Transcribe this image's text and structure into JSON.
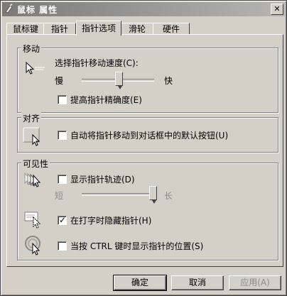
{
  "window": {
    "title": "鼠标 属性"
  },
  "tabs": [
    {
      "label": "鼠标键",
      "active": false
    },
    {
      "label": "指针",
      "active": false
    },
    {
      "label": "指针选项",
      "active": true
    },
    {
      "label": "滑轮",
      "active": false
    },
    {
      "label": "硬件",
      "active": false
    }
  ],
  "motion": {
    "title": "移动",
    "speed_label": "选择指针移动速度(C):",
    "slow": "慢",
    "fast": "快",
    "speed_level": 0.5,
    "precision_label": "提高指针精确度(E)",
    "precision_checked": false
  },
  "snap": {
    "title": "对齐",
    "label": "自动将指针移动到对话框中的默认按钮(U)",
    "checked": false
  },
  "visibility": {
    "title": "可见性",
    "trails_label": "显示指针轨迹(D)",
    "trails_checked": false,
    "short": "短",
    "long": "长",
    "trails_level": 1.0,
    "hide_label": "在打字时隐藏指针(H)",
    "hide_checked": true,
    "ctrl_label": "当按 CTRL 键时显示指针的位置(S)",
    "ctrl_checked": false
  },
  "buttons": {
    "ok": "确定",
    "cancel": "取消",
    "apply": "应用(A)"
  },
  "icons": {
    "title": "mouse-icon",
    "close": "close-icon",
    "motion": "pointer-speed-icon",
    "snap": "snap-to-default-icon",
    "trails": "pointer-trails-icon",
    "hide": "hide-while-typing-icon",
    "ctrl": "show-location-icon"
  }
}
